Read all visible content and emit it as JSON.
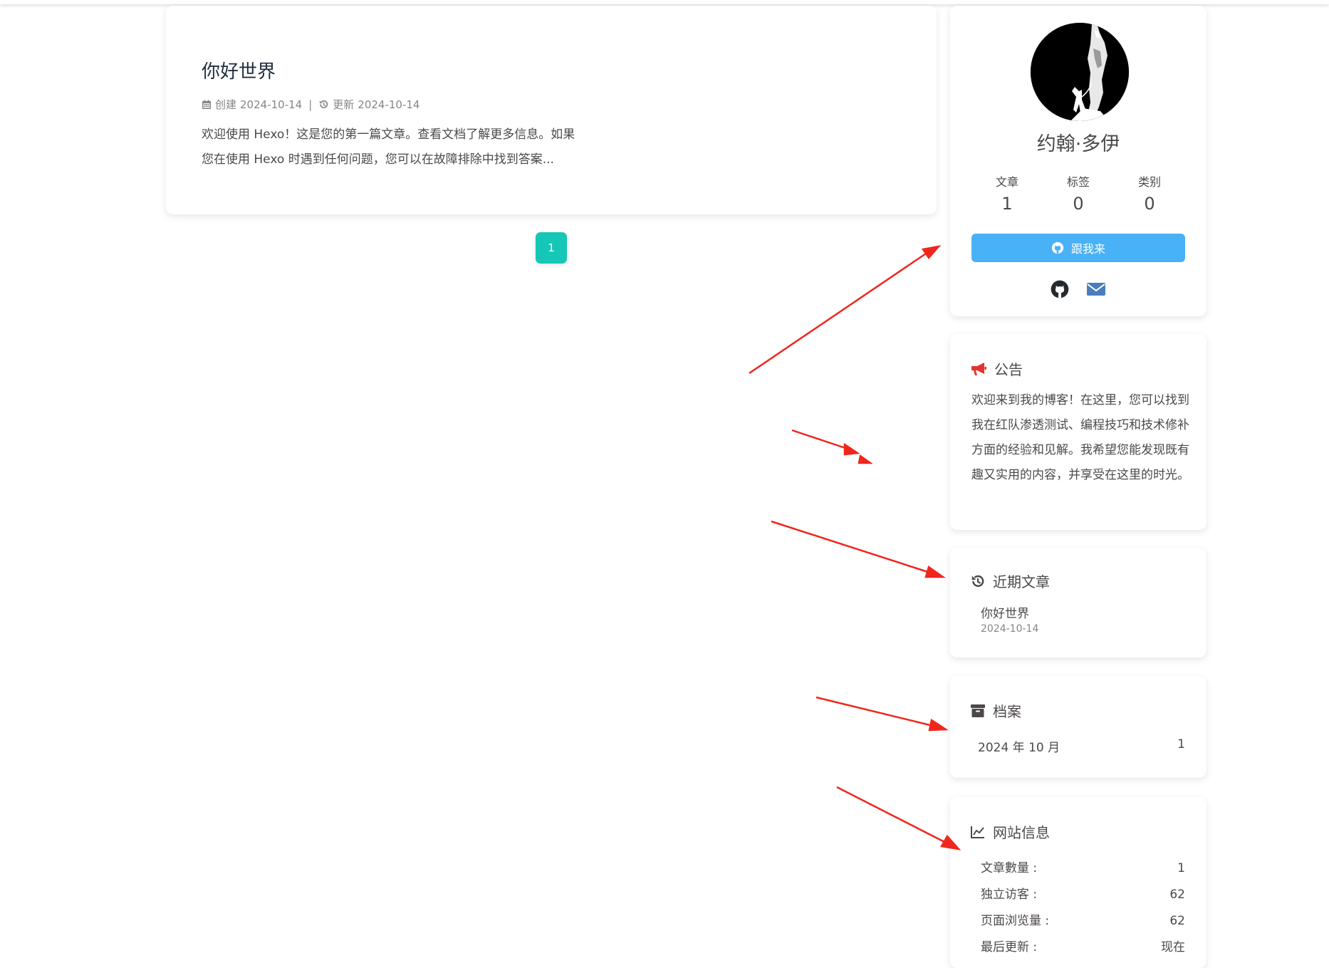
{
  "post": {
    "title": "你好世界",
    "created_label": "创建",
    "created_date": "2024-10-14",
    "separator": "|",
    "updated_label": "更新",
    "updated_date": "2024-10-14",
    "excerpt": "欢迎使用 Hexo！这是您的第一篇文章。查看文档了解更多信息。如果您在使用 Hexo 时遇到任何问题，您可以在故障排除中找到答案..."
  },
  "pagination": {
    "current_page": "1"
  },
  "author": {
    "name": "约翰·多伊",
    "stats": [
      {
        "label": "文章",
        "value": "1"
      },
      {
        "label": "标签",
        "value": "0"
      },
      {
        "label": "类别",
        "value": "0"
      }
    ],
    "follow_label": "跟我来"
  },
  "announcement": {
    "title": "公告",
    "text": "欢迎来到我的博客！在这里，您可以找到我在红队渗透测试、编程技巧和技术修补方面的经验和见解。我希望您能发现既有趣又实用的内容，并享受在这里的时光。"
  },
  "recent_posts": {
    "title": "近期文章",
    "items": [
      {
        "title": "你好世界",
        "date": "2024-10-14"
      }
    ]
  },
  "archive": {
    "title": "档案",
    "items": [
      {
        "month": "2024 年 10 月",
        "count": "1"
      }
    ]
  },
  "site_info": {
    "title": "网站信息",
    "rows": [
      {
        "label": "文章數量 :",
        "value": "1"
      },
      {
        "label": "独立访客 :",
        "value": "62"
      },
      {
        "label": "页面浏览量 :",
        "value": "62"
      },
      {
        "label": "最后更新 :",
        "value": "现在"
      }
    ]
  },
  "colors": {
    "accent_teal": "#16c7b7",
    "button_blue": "#49b1f5",
    "annotation_red": "#f0261d",
    "announce_icon_red": "#e3342f"
  },
  "icons": [
    "calendar-icon",
    "history-icon",
    "github-icon",
    "envelope-icon",
    "bullhorn-icon",
    "archive-icon",
    "chart-line-icon"
  ]
}
